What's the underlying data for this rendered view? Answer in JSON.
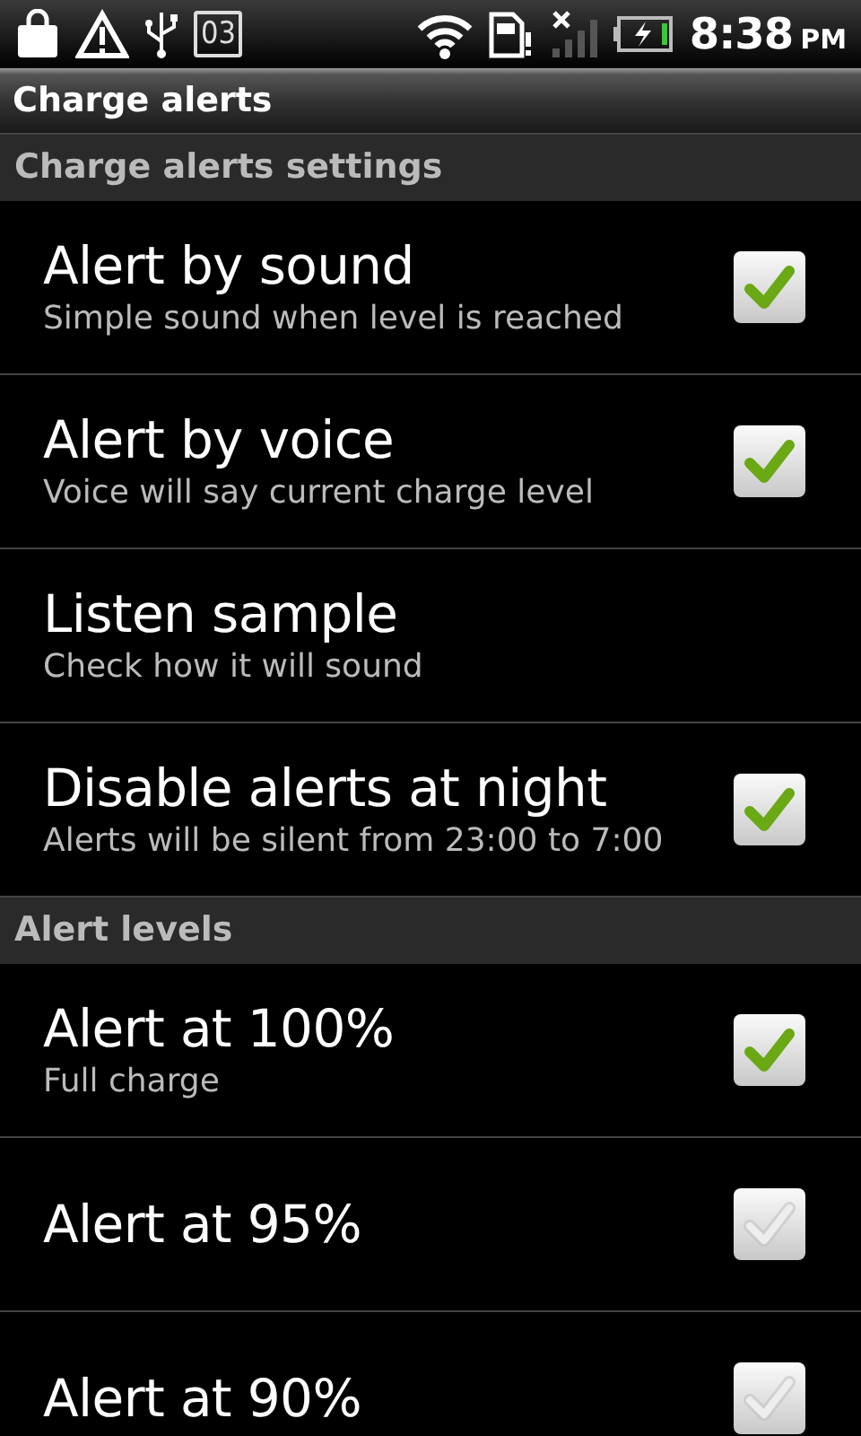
{
  "status_bar": {
    "notification_count": "03",
    "time": "8:38",
    "ampm": "PM"
  },
  "title": "Charge alerts",
  "sections": [
    {
      "header": "Charge alerts settings",
      "items": [
        {
          "kind": "checkbox",
          "title": "Alert by sound",
          "summary": "Simple sound when level is reached",
          "checked": true
        },
        {
          "kind": "checkbox",
          "title": "Alert by voice",
          "summary": "Voice will say current charge level",
          "checked": true
        },
        {
          "kind": "action",
          "title": "Listen sample",
          "summary": "Check how it will sound"
        },
        {
          "kind": "checkbox",
          "title": "Disable alerts at night",
          "summary": "Alerts will be silent from 23:00 to 7:00",
          "checked": true
        }
      ]
    },
    {
      "header": "Alert levels",
      "items": [
        {
          "kind": "checkbox",
          "title": "Alert at 100%",
          "summary": "Full charge",
          "checked": true
        },
        {
          "kind": "checkbox",
          "title": "Alert at 95%",
          "checked": false
        },
        {
          "kind": "checkbox",
          "title": "Alert at 90%",
          "checked": false
        }
      ]
    }
  ]
}
